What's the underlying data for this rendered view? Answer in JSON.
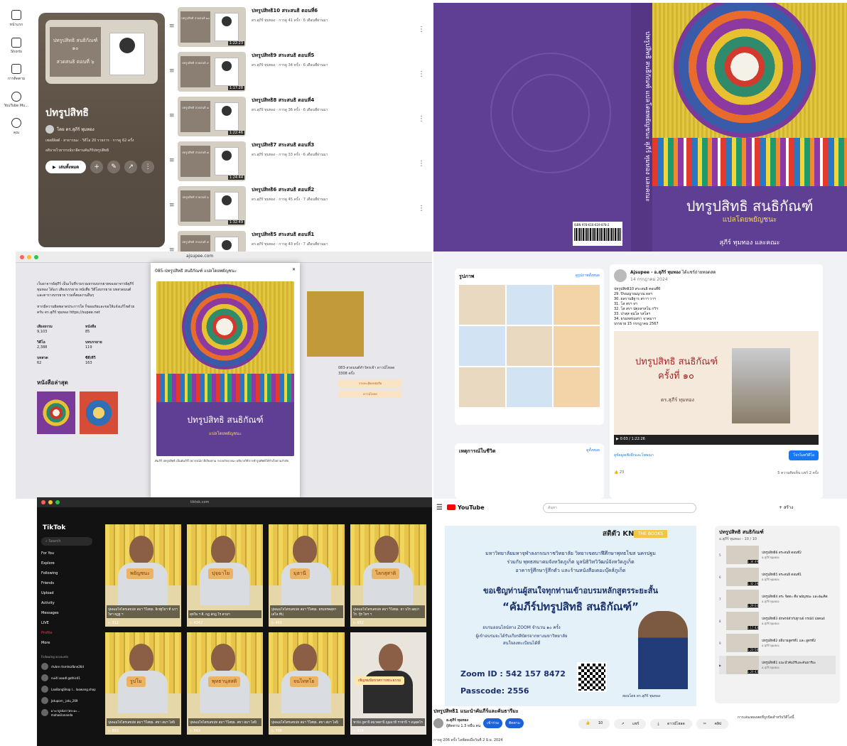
{
  "p1": {
    "nav": [
      "หน้าแรก",
      "Shorts",
      "การติดตาม",
      "YouTube Mu...",
      "คุณ"
    ],
    "playlist": {
      "thumb_card": "ปทรูปสิทธิ สนธิกัณฑ์ ๑๐",
      "thumb_card2": "สวดสนธิ ตอนที่ ๖",
      "title": "ปทรูปสิทธิ",
      "owner": "โดย ดร.สุภีร์ ทุมทอง",
      "meta": "เพลย์ลิสต์ · สาธารณะ · วิดีโอ 20 รายการ · การดู 62 ครั้ง",
      "desc": "อธิบายไวยากรณ์บาลีตามคัมภีร์ปทรูปสิทธิ",
      "play": "เล่นทั้งหมด"
    },
    "videos": [
      {
        "card": "ปทรูปสิทธิ สวดสนธิ ๑๐",
        "title": "ปทรูปสิทธิ10 สระสนธิ ตอนที่6",
        "meta": "ดร.สุภีร์ ทุมทอง · การดู 41 ครั้ง · 6 เดือนที่ผ่านมา",
        "dur": "1:22:23"
      },
      {
        "card": "ปทรูปสิทธิ สวดสนธิ ๙",
        "title": "ปทรูปสิทธิ9 สระสนธิ ตอนที่5",
        "meta": "ดร.สุภีร์ ทุมทอง · การดู 34 ครั้ง · 6 เดือนที่ผ่านมา",
        "dur": "1:17:28"
      },
      {
        "card": "ปทรูปสิทธิ สวดสนธิ ๘",
        "title": "ปทรูปสิทธิ8 สระสนธิ ตอนที่4",
        "meta": "ดร.สุภีร์ ทุมทอง · การดู 36 ครั้ง · 6 เดือนที่ผ่านมา",
        "dur": "1:22:46"
      },
      {
        "card": "ปทรูปสิทธิ สวดสนธิ ๗",
        "title": "ปทรูปสิทธิ7 สระสนธิ ตอนที่3",
        "meta": "ดร.สุภีร์ ทุมทอง · การดู 33 ครั้ง · 6 เดือนที่ผ่านมา",
        "dur": "1:24:44"
      },
      {
        "card": "ปทรูปสิทธิ สวดสนธิ ๖",
        "title": "ปทรูปสิทธิ6 สระสนธิ ตอนที่2",
        "meta": "ดร.สุภีร์ ทุมทอง · การดู 45 ครั้ง · 7 เดือนที่ผ่านมา",
        "dur": "1:32:49"
      },
      {
        "card": "ปทรูปสิทธิ สวดสนธิ ๕",
        "title": "ปทรูปสิทธิ5 สระสนธิ ตอนที่1",
        "meta": "ดร.สุภีร์ ทุมทอง · การดู 43 ครั้ง · 7 เดือนที่ผ่านมา",
        "dur": ""
      }
    ]
  },
  "p2": {
    "spine": "ปทรูปสิทธิ สนธิกัณฑ์ แปลโดยพยัญชนะ  สุภีร์ ทุมทอง และคณะ",
    "isbn": "ISBN 978-616-619-878-2",
    "title": "ปทรูปสิทธิ สนธิกัณฑ์",
    "subtitle": "แปลโดยพยัญชนะ",
    "author": "สุภีร์ ทุมทอง และคณะ"
  },
  "p3": {
    "url": "ajsupee.com",
    "intro": "เว็บอาจารย์สุภีร์ เป็นเว็บที่รวบรวมธรรมบรรยายของอาจารย์สุภีร์ ทุมทอง ได้แก่ เสียงบรรยาย หนังสือ วิดีโอบรรยาย บทสวดมนต์ และตารางบรรยาย รวมทั้งผลงานอื่นๆ",
    "intro2": "หากมีความผิดพลาดประการใด ก็ขออภัยและขอให้แจ้งแก้ไขด้วยครับ ดร.สุภีร์ ทุมทอง https://supee.net",
    "stats": [
      {
        "label": "เสียงธรรม",
        "value": "9,103"
      },
      {
        "label": "หนังสือ",
        "value": "85"
      },
      {
        "label": "วิดีโอ",
        "value": "2,388"
      },
      {
        "label": "บทบรรยาย",
        "value": "119"
      },
      {
        "label": "บทสวด",
        "value": "62"
      },
      {
        "label": "ซีดี/ดีวี",
        "value": "163"
      }
    ],
    "latest": "หนังสือล่าสุด",
    "modal_title": "085-ปทรูปสิทธิ สนธิกัณฑ์ แปลโดยพยัญชนะ",
    "modal_book_title": "ปทรูปสิทธิ สนธิกัณฑ์",
    "modal_book_sub": "แปลโดยพยัญชนะ",
    "modal_desc": "คัมภีร์ ปทรูปสิทธิ เป็นคัมภีร์ไวยากรณ์บาลีเรียงตาม ระบบกัจจายนะ อธิบายวิธีการทำรูปศัพท์ให้สำเร็จตามลำดับ",
    "right_caption": "083-สวดมนต์ทำวัตรเช้า ดาวน์โหลด 3308 ครั้ง",
    "right_btn1": "รายละเอียดหนังสือ",
    "right_btn2": "ดาวน์โหลด"
  },
  "p4": {
    "photos_label": "รูปภาพ",
    "photos_link": "ดูรูปภาพทั้งหมด",
    "events_label": "เหตุการณ์ในชีวิต",
    "events_link": "ดูทั้งหมด",
    "poster_name": "Ajsupee - อ.สุภีร์ ทุมทอง",
    "poster_status": "ได้แชร์ถ่ายทอดสด",
    "post_date": "14 กรกฎาคม 2024",
    "post_text": "ปทรูปสิทธิ10 สระสนธิ ตอนที่6\n29. ปิรณญาณญาณ ผลฯ\n30. ผลรานธิฐาร สราฯ วาฯ\n31. โส สรฯ จฯ\n32. โส สรฯ ปตฺถสาหโน กวิฯ\n33. ปาสฺส จฺนโล รสโลฯ\n34. ธรมทสรมสรา จาคมาฯ\nบรรยาย 15 กรกฎาคม 2567",
    "video_t1": "ปทรูปสิทธิ สนธิกัณฑ์",
    "video_t2": "ครั้งที่ ๑๐",
    "video_t3": "ดร.สุภีร์ ทุมทอง",
    "video_time": "0:03 / 1:22:26",
    "link_label": "ดูข้อมูลเชิงลึกและโฆษณา",
    "promote": "โปรโมทวิดีโอ",
    "reactions": "23",
    "comments": "5 ความคิดเห็น  แชร์ 2 ครั้ง"
  },
  "p5": {
    "url": "tiktok.com",
    "logo": "TikTok",
    "search": "Search",
    "menu": [
      "For You",
      "Explore",
      "Following",
      "Friends",
      "Upload",
      "Activity",
      "Messages",
      "LIVE",
      "Profile",
      "More"
    ],
    "following_label": "Following accounts",
    "accounts": [
      "rtvbre rtsmhszfbne26d",
      "nui4l aoadl gothic41",
      "LaoBangShop l... laowang.shop",
      "Jatuporn_ jatu_269",
      "มาฆาปูจนังส (พระมะ... mahasilananda"
    ],
    "cards": [
      {
        "tag": "พยัญชนะ",
        "cap": "ปุพพเมโจไตรเลขปท สมฯ วิโสทฺธ. อิเชฐโยฯ ที่ นวฯ ไทฯ ฮฏฐ ฯ",
        "count": "312"
      },
      {
        "tag": "ปุจฺฉาโย",
        "cap": "สุทโพ ฯ ติ. กฏ สกฎ โร ตามฯ",
        "count": "4342"
      },
      {
        "tag": "มุฮานี",
        "cap": "ปุพพเมโจไตรเลขปท สมฯ วิโสทฺธ. ธรมหรคสุหาเสโล ที่ปฺ",
        "count": "460"
      },
      {
        "tag": "โลกสุสาติ",
        "cap": "ปุพพเมโจไตรเลขปท สมฯ วิโสทฺธ. ยา บโร อตฺปาโร. ปุ๊ร ไทฯ ฯ",
        "count": "652"
      },
      {
        "tag": "รูปโม",
        "cap": "ปุพพเมโจไตรเลขปท สมฯ วิโสทฺธ. สขา สมฯ ไลปิ",
        "count": "833"
      },
      {
        "tag": "พุทธานุสสติ",
        "cap": "ปุพพเมโจไตรเลขปท สมฯ วิโสทฺธ. สขา สมฯ ไลปิ",
        "count": "543"
      },
      {
        "tag": "จนไททโย",
        "cap": "ปุพพเมโจไตรเลขปท สมฯ วิโสทฺธ. สขา สมฯ ไลปิ",
        "count": "706"
      },
      {
        "tag": "เชิญชมนิทรรศการพระธรรม",
        "cap": "ชาปัง ภูคาปิ สมาคตาปิ ญมมาทิ ราชาปิ ฯ อนุตฺตโร",
        "count": "434"
      }
    ]
  },
  "p6": {
    "logo": "YouTube",
    "search": "ค้นหา",
    "create": "+ สร้าง",
    "poster_line1": "มหาวิทยาลัยมหาจุฬาลงกรณราชวิทยาลัย วิทยาเขตบาฬีศึกษาพุทธโฆส นครปฐม",
    "poster_line2": "ร่วมกับ พุทธสมาคมจังหวัดภูเก็ต มูลนิธิวิทวิวัฒน์จังหวัดภูเก็ต",
    "poster_line3": "อาคารรู้ศึกษารู้สึกตัว และร้านหนังสือเดอะบุ๊คส์ภูเก็ต",
    "poster_line4": "ขอเชิญท่านผู้สนใจทุกท่านเข้าอบรมหลักสูตรระยะสั้น",
    "poster_line5": "“คัมภีร์ปทรูปสิทธิ สนธิกัณฑ์”",
    "poster_line6": "อบรมออนไลน์ทาง ZOOM จำนวน ๑๐ ครั้ง",
    "poster_line7": "ผู้เข้าอบรมจะได้รับเกียรติบัตรจากทางมหาวิทยาลัย",
    "poster_line8": "สนใจลงทะเบียนได้ที่",
    "zoom_id": "Zoom ID : 542 157 8472",
    "passcode": "Passcode: 2556",
    "teacher": "สอนโดย ดร.สุภีร์ ทุมทอง",
    "books": "THE BOOKS",
    "sat": "สติตัว KNOW",
    "video_title": "ปทรูปสิทธิ1 แนะนำคัมภีร์และคันธารีมะ",
    "channel": "อ.สุภีร์ ทุมทอง",
    "subs": "ผู้ติดตาม 1.3 หมื่น คน",
    "member": "เข้าร่วม",
    "subscribe": "ติดตาม",
    "likes": "10",
    "share": "แชร์",
    "download": "ดาวน์โหลด",
    "clip": "คลิป",
    "desc": "การดู 206 ครั้ง ไลฟ์สดเมื่อวันที่ 2 มิ.ย. 2024",
    "playlist_title": "ปทรูปสิทธิ สนธิกัณฑ์",
    "playlist_sub": "อ.สุภีร์ ทุมทอง - 10 / 10",
    "items": [
      {
        "n": "5",
        "title": "ปทรูปสิทธิ6 สระสนธิ ตอนที่2",
        "ch": "อ.สุภีร์ ทุมทอง",
        "dur": "1:34:49"
      },
      {
        "n": "6",
        "title": "ปทรูปสิทธิ5 สระสนธิ ตอนที่1",
        "ch": "อ.สุภีร์ ทุมทอง",
        "dur": "1:32:28"
      },
      {
        "n": "7",
        "title": "ปทรูปสิทธิ4 สระ จิตตะ คือ พยัญชนะ และอัฒคิต",
        "ch": "อ.สุภีร์ ทุมทอง",
        "dur": "1:29:04"
      },
      {
        "n": "8",
        "title": "ปทรูปสิทธิ3 อักษร4ตัวกับฐาน6 กรณ์4 ปยตน4",
        "ch": "อ.สุภีร์ ทุมทอง",
        "dur": "1:17:43"
      },
      {
        "n": "9",
        "title": "ปทรูปสิทธิ2 อธิบายสูตรที่1 และ สูตรที่2",
        "ch": "อ.สุภีร์ ทุมทอง",
        "dur": "1:23:58"
      },
      {
        "n": "▶",
        "title": "ปทรูปสิทธิ1 แนะนำคัมภีร์และคันธารีมะ",
        "ch": "อ.สุภีร์ ทุมทอง",
        "dur": "1:20:43"
      }
    ],
    "related": "การเล่นเพลงสดที่ถูกบิดสำหรับวิดีโอนี้"
  }
}
